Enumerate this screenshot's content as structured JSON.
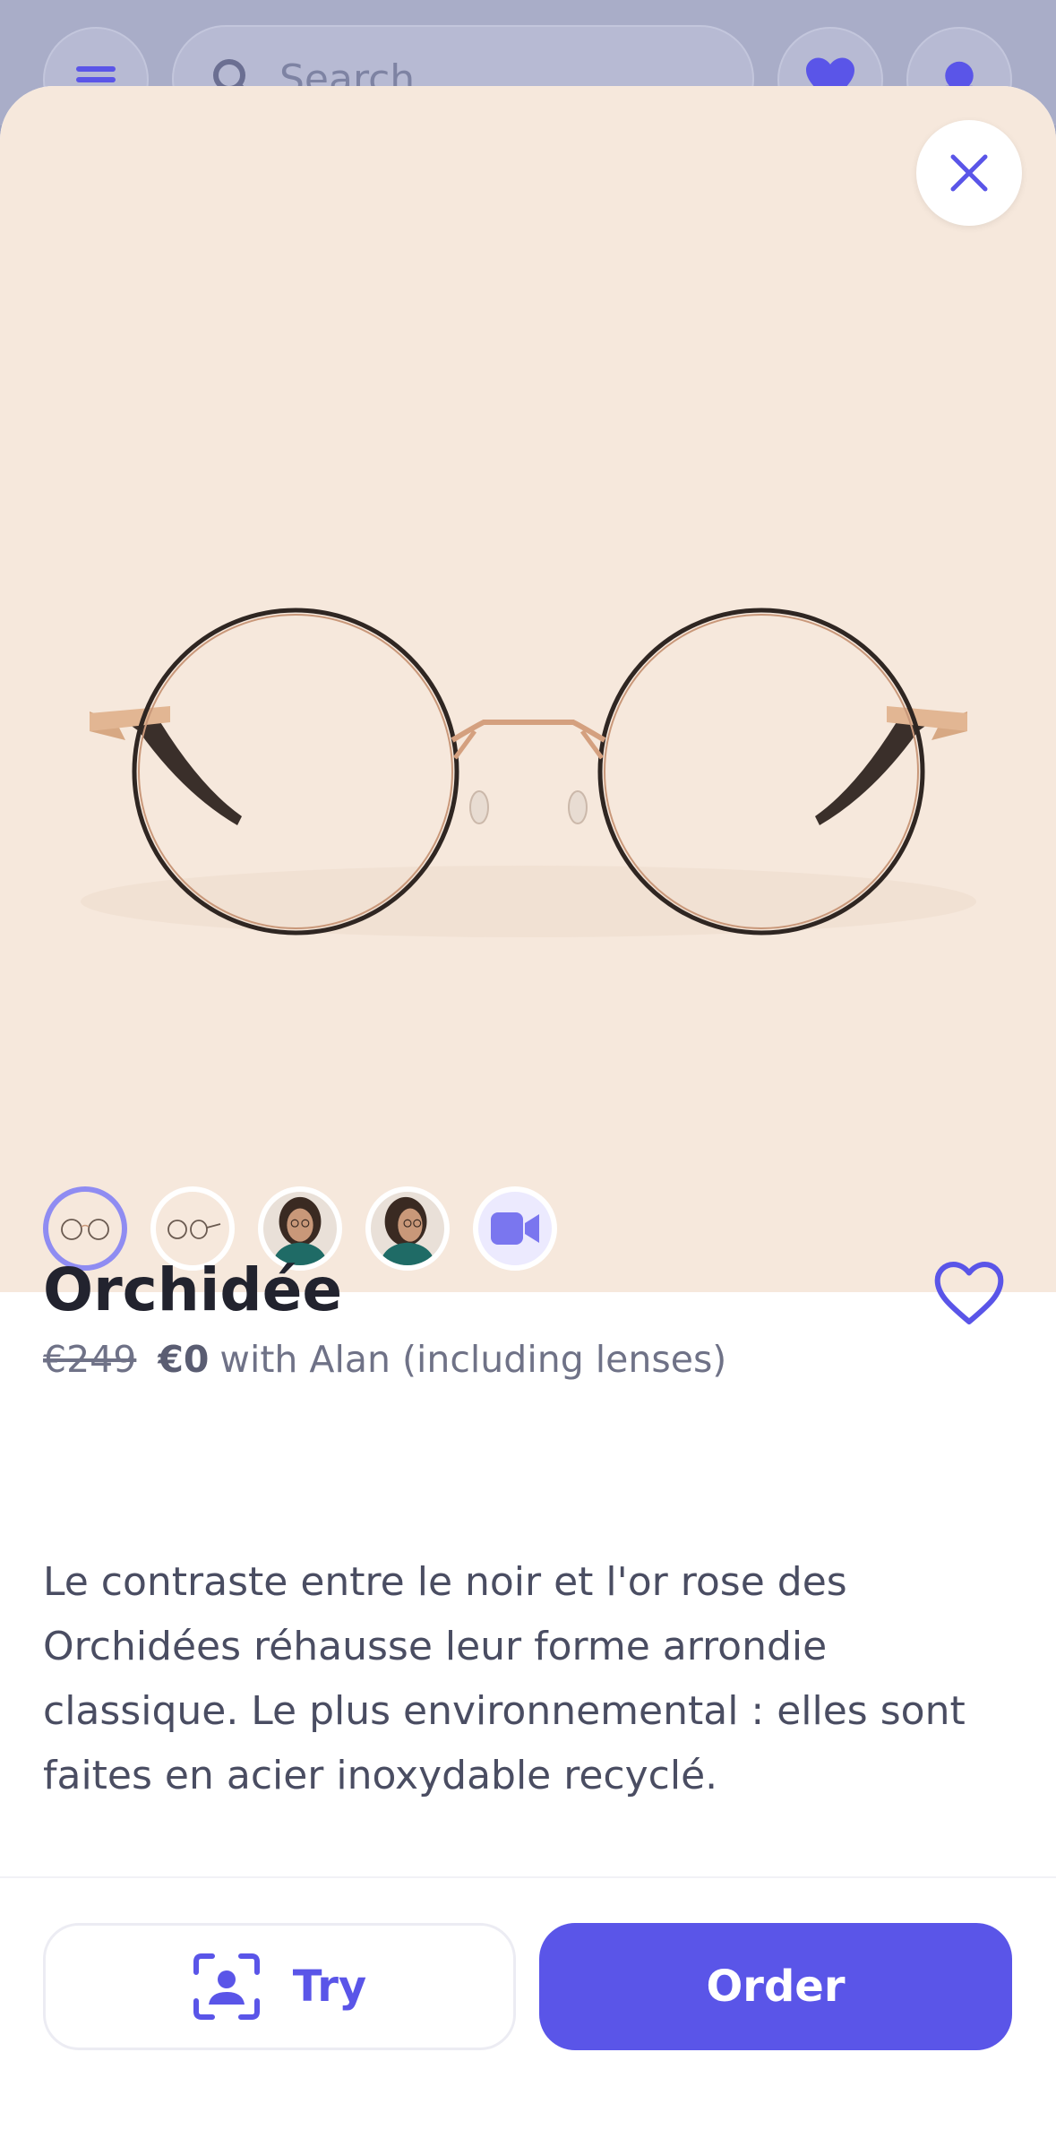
{
  "background": {
    "search_placeholder": "Search",
    "menu_icon": "menu-icon",
    "heart_icon": "heart-icon",
    "profile_icon": "profile-icon"
  },
  "product": {
    "name": "Orchidée",
    "old_price": "€249",
    "price": "€0",
    "price_note": "with Alan (including lenses)",
    "description": "Le contraste entre le noir et l'or rose des Orchidées réhausse leur forme arrondie classique. Le plus environnemental : elles sont faites en acier inoxydable recyclé."
  },
  "gallery": {
    "thumbnails": [
      "glasses-front",
      "glasses-side",
      "model-front",
      "model-side",
      "video"
    ],
    "active_index": 0
  },
  "actions": {
    "try_label": "Try",
    "order_label": "Order"
  },
  "colors": {
    "accent": "#5a55e8",
    "hero_background": "#f6e8dc"
  }
}
